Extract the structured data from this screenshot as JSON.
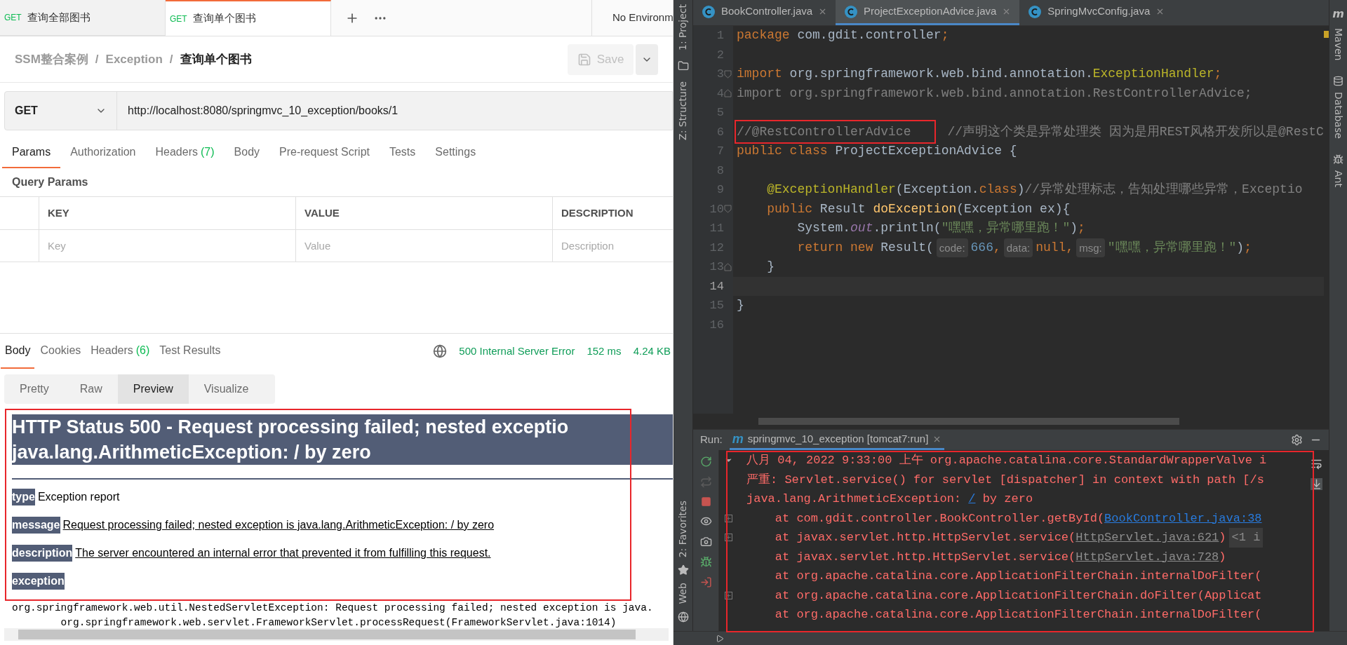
{
  "request_tabs_bar": {
    "tabs": [
      {
        "method": "GET",
        "name": "查询全部图书",
        "selected": false
      },
      {
        "method": "GET",
        "name": "查询单个图书",
        "selected": true
      }
    ],
    "environment": "No Environm"
  },
  "breadcrumb": [
    "SSM整合案例",
    "/",
    "Exception",
    "/",
    "查询单个图书"
  ],
  "save_button": {
    "label": "Save",
    "disabled": true
  },
  "request": {
    "method": "GET",
    "url": "http://localhost:8080/springmvc_10_exception/books/1"
  },
  "request_tabs": [
    {
      "label": "Params",
      "selected": true
    },
    {
      "label": "Authorization",
      "selected": false
    },
    {
      "label": "Headers",
      "count": "(7)",
      "selected": false
    },
    {
      "label": "Body",
      "selected": false
    },
    {
      "label": "Pre-request Script",
      "selected": false
    },
    {
      "label": "Tests",
      "selected": false
    },
    {
      "label": "Settings",
      "selected": false
    }
  ],
  "query_params": {
    "title": "Query Params",
    "columns": [
      "KEY",
      "VALUE",
      "DESCRIPTION"
    ],
    "placeholders": [
      "Key",
      "Value",
      "Description"
    ]
  },
  "response": {
    "tabs": [
      {
        "label": "Body",
        "selected": true
      },
      {
        "label": "Cookies",
        "selected": false
      },
      {
        "label": "Headers",
        "count": "(6)",
        "selected": false
      },
      {
        "label": "Test Results",
        "selected": false
      }
    ],
    "status": "500 Internal Server Error",
    "time": "152 ms",
    "size": "4.24 KB",
    "view_modes": [
      {
        "label": "Pretty",
        "selected": false
      },
      {
        "label": "Raw",
        "selected": false
      },
      {
        "label": "Preview",
        "selected": true
      },
      {
        "label": "Visualize",
        "selected": false
      }
    ]
  },
  "preview": {
    "heading_lines": [
      "HTTP Status 500 - Request processing failed; nested exceptio",
      "java.lang.ArithmeticException: / by zero"
    ],
    "fields": [
      {
        "label": "type",
        "text": "Exception report",
        "underlined": false
      },
      {
        "label": "message",
        "text": "Request processing failed; nested exception is java.lang.ArithmeticException: / by zero",
        "underlined": true
      },
      {
        "label": "description",
        "text": "The server encountered an internal error that prevented it from fulfilling this request.",
        "underlined": true
      },
      {
        "label": "exception"
      }
    ],
    "exception_lines": [
      "org.springframework.web.util.NestedServletException: Request processing failed; nested exception is java.",
      "        org.springframework.web.servlet.FrameworkServlet.processRequest(FrameworkServlet.java:1014)"
    ]
  },
  "ide": {
    "top_tools": [
      "1: Project",
      "Z: Structure"
    ],
    "bottom_tools": [
      "2: Favorites",
      "Web"
    ],
    "right_badge": "m",
    "right_tools": [
      "Maven",
      "Database",
      "Ant"
    ],
    "editor_tabs": [
      {
        "name": "BookController.java",
        "selected": false
      },
      {
        "name": "ProjectExceptionAdvice.java",
        "selected": true
      },
      {
        "name": "SpringMvcConfig.java",
        "selected": false
      }
    ],
    "code_lines": [
      {
        "number": "1",
        "kind": "line",
        "tokens": [
          {
            "t": "package",
            "kind": "kw"
          },
          {
            "t": " com.gdit.controller",
            "kind": "plain"
          },
          {
            "t": ";",
            "kind": "kw"
          }
        ]
      },
      {
        "number": "2",
        "kind": "line"
      },
      {
        "number": "3",
        "kind": "fold_start",
        "tokens": [
          {
            "t": "import",
            "kind": "kw"
          },
          {
            "t": " org.springframework.web.bind.annotation.",
            "kind": "plain"
          },
          {
            "t": "ExceptionHandler",
            "kind": "ann"
          },
          {
            "t": ";",
            "kind": "kw"
          }
        ]
      },
      {
        "number": "4",
        "kind": "fold_end",
        "tokens": [
          {
            "t": "import org.springframework.web.bind.annotation.RestControllerAdvice;",
            "kind": "dim"
          }
        ]
      },
      {
        "number": "5",
        "kind": "line"
      },
      {
        "number": "6",
        "kind": "line",
        "tokens": [
          {
            "t": "//@RestControllerAdvice",
            "kind": "cmt",
            "boxed": true
          },
          {
            "t": "//声明这个类是异常处理类 因为是用REST风格开发所以是@RestC",
            "kind": "cmt",
            "boxed": false
          }
        ]
      },
      {
        "number": "7",
        "kind": "line",
        "tokens": [
          {
            "t": "public class",
            "kind": "kw"
          },
          {
            "t": " ProjectExceptionAdvice {",
            "kind": "plain"
          }
        ]
      },
      {
        "number": "8",
        "kind": "line"
      },
      {
        "number": "9",
        "kind": "line",
        "tokens": [
          {
            "t": "    @ExceptionHandler",
            "kind": "ann"
          },
          {
            "t": "(Exception.",
            "kind": "plain"
          },
          {
            "t": "class",
            "kind": "kw"
          },
          {
            "t": ")",
            "kind": "plain"
          },
          {
            "t": "//异常处理标志，告知处理哪些异常，Exceptio",
            "kind": "cmt"
          }
        ]
      },
      {
        "number": "10",
        "kind": "fold_start",
        "tokens": [
          {
            "t": "    public",
            "kind": "kw"
          },
          {
            "t": " Result ",
            "kind": "plain"
          },
          {
            "t": "doException",
            "kind": "method"
          },
          {
            "t": "(Exception ex){",
            "kind": "plain"
          }
        ]
      },
      {
        "number": "11",
        "kind": "line",
        "tokens": [
          {
            "t": "        System.",
            "kind": "plain"
          },
          {
            "t": "out",
            "kind": "field"
          },
          {
            "t": ".println(",
            "kind": "plain"
          },
          {
            "t": "\"嘿嘿，异常哪里跑！\"",
            "kind": "str"
          },
          {
            "t": ")",
            "kind": "plain"
          },
          {
            "t": ";",
            "kind": "kw"
          }
        ]
      },
      {
        "number": "12",
        "kind": "line",
        "tokens": [
          {
            "t": "        return new",
            "kind": "kw"
          },
          {
            "t": " Result(",
            "kind": "plain"
          },
          {
            "t": "code:",
            "kind": "hint"
          },
          {
            "t": "666",
            "kind": "num"
          },
          {
            "t": ",",
            "kind": "kw"
          },
          {
            "t": "data:",
            "kind": "hint"
          },
          {
            "t": "null",
            "kind": "kw"
          },
          {
            "t": ",",
            "kind": "kw"
          },
          {
            "t": "msg:",
            "kind": "hint"
          },
          {
            "t": "\"嘿嘿，异常哪里跑！\"",
            "kind": "str"
          },
          {
            "t": ")",
            "kind": "plain"
          },
          {
            "t": ";",
            "kind": "kw"
          }
        ]
      },
      {
        "number": "13",
        "kind": "fold_end",
        "tokens": [
          {
            "t": "    }",
            "kind": "plain"
          }
        ]
      },
      {
        "number": "14",
        "kind": "line",
        "current": true
      },
      {
        "number": "15",
        "kind": "line",
        "tokens": [
          {
            "t": "}",
            "kind": "plain"
          }
        ]
      },
      {
        "number": "16",
        "kind": "line"
      }
    ],
    "run_panel": {
      "label": "Run:",
      "config_badge": "m",
      "config": "springmvc_10_exception [tomcat7:run]",
      "console_lines": [
        {
          "kind": "group_open",
          "tokens": [
            {
              "t": "八月 04, 2022 9:33:00 上午 org.apache.catalina.core.StandardWrapperValve i",
              "kind": "text"
            }
          ]
        },
        {
          "kind": "line",
          "tokens": [
            {
              "t": "严重: Servlet.service() for servlet [dispatcher] in context with path [/s",
              "kind": "text"
            }
          ]
        },
        {
          "kind": "line",
          "tokens": [
            {
              "t": "java.lang.ArithmeticException: ",
              "kind": "text"
            },
            {
              "t": "/",
              "kind": "link"
            },
            {
              "t": " by zero",
              "kind": "text"
            }
          ]
        },
        {
          "kind": "group_closed",
          "tokens": [
            {
              "t": "    at com.gdit.controller.BookController.getById(",
              "kind": "text"
            },
            {
              "t": "BookController.java:38",
              "kind": "link"
            }
          ]
        },
        {
          "kind": "group_closed",
          "tokens": [
            {
              "t": "    at javax.servlet.http.HttpServlet.service(",
              "kind": "text"
            },
            {
              "t": "HttpServlet.java:621",
              "kind": "file"
            },
            {
              "t": ")",
              "kind": "text"
            },
            {
              "t": "<1 i",
              "kind": "hint"
            }
          ]
        },
        {
          "kind": "line",
          "tokens": [
            {
              "t": "    at javax.servlet.http.HttpServlet.service(",
              "kind": "text"
            },
            {
              "t": "HttpServlet.java:728",
              "kind": "file"
            },
            {
              "t": ")",
              "kind": "text"
            }
          ]
        },
        {
          "kind": "line",
          "tokens": [
            {
              "t": "    at org.apache.catalina.core.ApplicationFilterChain.internalDoFilter(",
              "kind": "text"
            }
          ]
        },
        {
          "kind": "group_closed",
          "tokens": [
            {
              "t": "    at org.apache.catalina.core.ApplicationFilterChain.doFilter(Applicat",
              "kind": "text"
            }
          ]
        },
        {
          "kind": "line",
          "tokens": [
            {
              "t": "    at org.apache.catalina.core.ApplicationFilterChain.internalDoFilter(",
              "kind": "text"
            }
          ]
        }
      ]
    }
  }
}
